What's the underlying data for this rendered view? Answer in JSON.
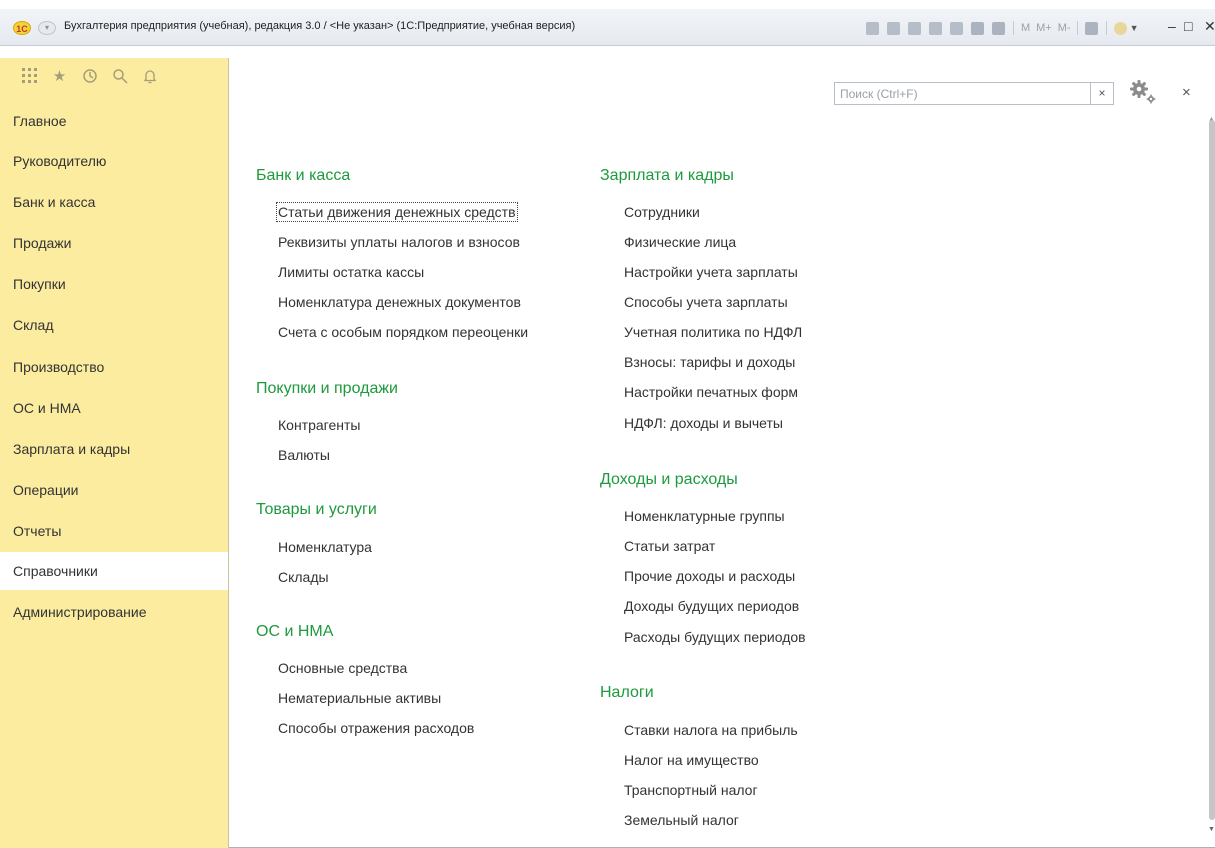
{
  "window": {
    "logo": "1С",
    "title": "Бухгалтерия предприятия (учебная), редакция 3.0 / <Не указан>  (1С:Предприятие, учебная версия)",
    "toolbar_text": [
      "M",
      "M+",
      "M-"
    ],
    "minimize": "–",
    "maximize": "□",
    "close": "✕"
  },
  "sidebar": {
    "icons": [
      "apps-grid-icon",
      "favorites-star-icon",
      "history-icon",
      "search-icon",
      "notifications-bell-icon"
    ],
    "items": [
      {
        "label": "Главное"
      },
      {
        "label": "Руководителю"
      },
      {
        "label": "Банк и касса"
      },
      {
        "label": "Продажи"
      },
      {
        "label": "Покупки"
      },
      {
        "label": "Склад"
      },
      {
        "label": "Производство"
      },
      {
        "label": "ОС и НМА"
      },
      {
        "label": "Зарплата и кадры"
      },
      {
        "label": "Операции"
      },
      {
        "label": "Отчеты"
      },
      {
        "label": "Справочники",
        "active": true
      },
      {
        "label": "Администрирование"
      }
    ]
  },
  "search": {
    "placeholder": "Поиск (Ctrl+F)",
    "value": "",
    "clear": "×"
  },
  "panel": {
    "close": "×"
  },
  "sections": {
    "bank": {
      "title": "Банк и касса",
      "links": [
        "Статьи движения денежных средств",
        "Реквизиты уплаты налогов и взносов",
        "Лимиты остатка кассы",
        "Номенклатура денежных документов",
        "Счета с особым порядком переоценки"
      ]
    },
    "purchases_sales": {
      "title": "Покупки и продажи",
      "links": [
        "Контрагенты",
        "Валюты"
      ]
    },
    "goods": {
      "title": "Товары и услуги",
      "links": [
        "Номенклатура",
        "Склады"
      ]
    },
    "fixed_assets": {
      "title": "ОС и НМА",
      "links": [
        "Основные средства",
        "Нематериальные активы",
        "Способы отражения расходов"
      ]
    },
    "salary": {
      "title": "Зарплата и кадры",
      "links": [
        "Сотрудники",
        "Физические лица",
        "Настройки учета зарплаты",
        "Способы учета зарплаты",
        "Учетная политика по НДФЛ",
        "Взносы: тарифы и доходы",
        "Настройки печатных форм",
        "НДФЛ: доходы и вычеты"
      ]
    },
    "income_expense": {
      "title": "Доходы и расходы",
      "links": [
        "Номенклатурные группы",
        "Статьи затрат",
        "Прочие доходы и расходы",
        "Доходы будущих периодов",
        "Расходы будущих периодов"
      ]
    },
    "taxes": {
      "title": "Налоги",
      "links": [
        "Ставки налога на прибыль",
        "Налог на имущество",
        "Транспортный налог",
        "Земельный налог"
      ]
    }
  },
  "colors": {
    "sidebar_bg": "#fbeca0",
    "section_title": "#1d9a3c",
    "active_item_bg": "#ffffff"
  }
}
